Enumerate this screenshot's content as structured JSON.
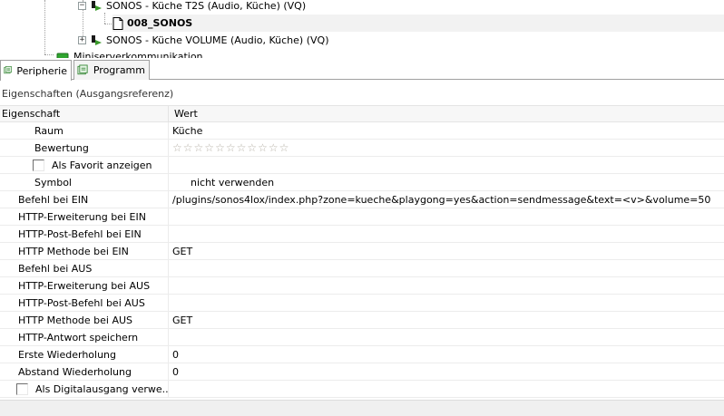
{
  "tree": {
    "items": [
      {
        "label": "SONOS - Küche T2S (Audio, Küche) (VQ)",
        "expander": "−"
      },
      {
        "label": "008_SONOS"
      },
      {
        "label": "SONOS - Küche VOLUME (Audio, Küche) (VQ)",
        "expander": "+"
      },
      {
        "label": "Miniserverkommunikation"
      }
    ]
  },
  "tabs": [
    {
      "label": "Peripherie"
    },
    {
      "label": "Programm"
    }
  ],
  "section_title": "Eigenschaften (Ausgangsreferenz)",
  "grid": {
    "header": {
      "property": "Eigenschaft",
      "value": "Wert"
    },
    "rows": [
      {
        "name": "Raum",
        "value": "Küche"
      },
      {
        "name": "Bewertung",
        "value": ""
      },
      {
        "name": "Als Favorit anzeigen",
        "value": ""
      },
      {
        "name": "Symbol",
        "value": "nicht verwenden"
      },
      {
        "name": "Befehl bei EIN",
        "value": "/plugins/sonos4lox/index.php?zone=kueche&playgong=yes&action=sendmessage&text=<v>&volume=50"
      },
      {
        "name": "HTTP-Erweiterung bei EIN",
        "value": ""
      },
      {
        "name": "HTTP-Post-Befehl bei EIN",
        "value": ""
      },
      {
        "name": "HTTP Methode bei EIN",
        "value": "GET"
      },
      {
        "name": "Befehl bei AUS",
        "value": ""
      },
      {
        "name": "HTTP-Erweiterung bei AUS",
        "value": ""
      },
      {
        "name": "HTTP-Post-Befehl bei AUS",
        "value": ""
      },
      {
        "name": "HTTP Methode bei AUS",
        "value": "GET"
      },
      {
        "name": "HTTP-Antwort speichern",
        "value": ""
      },
      {
        "name": "Erste Wiederholung",
        "value": "0"
      },
      {
        "name": "Abstand Wiederholung",
        "value": "0"
      },
      {
        "name": "Als Digitalausgang verwe...",
        "value": ""
      }
    ],
    "rating": {
      "stars": [
        "☆",
        "☆",
        "☆",
        "☆",
        "☆",
        "☆",
        "☆",
        "☆",
        "☆",
        "☆",
        "☆"
      ]
    }
  },
  "colors": {
    "output_icon_green": "#3a9a2a",
    "output_icon_dark": "#1a1a1a",
    "server_icon_green": "#2fa52f"
  }
}
